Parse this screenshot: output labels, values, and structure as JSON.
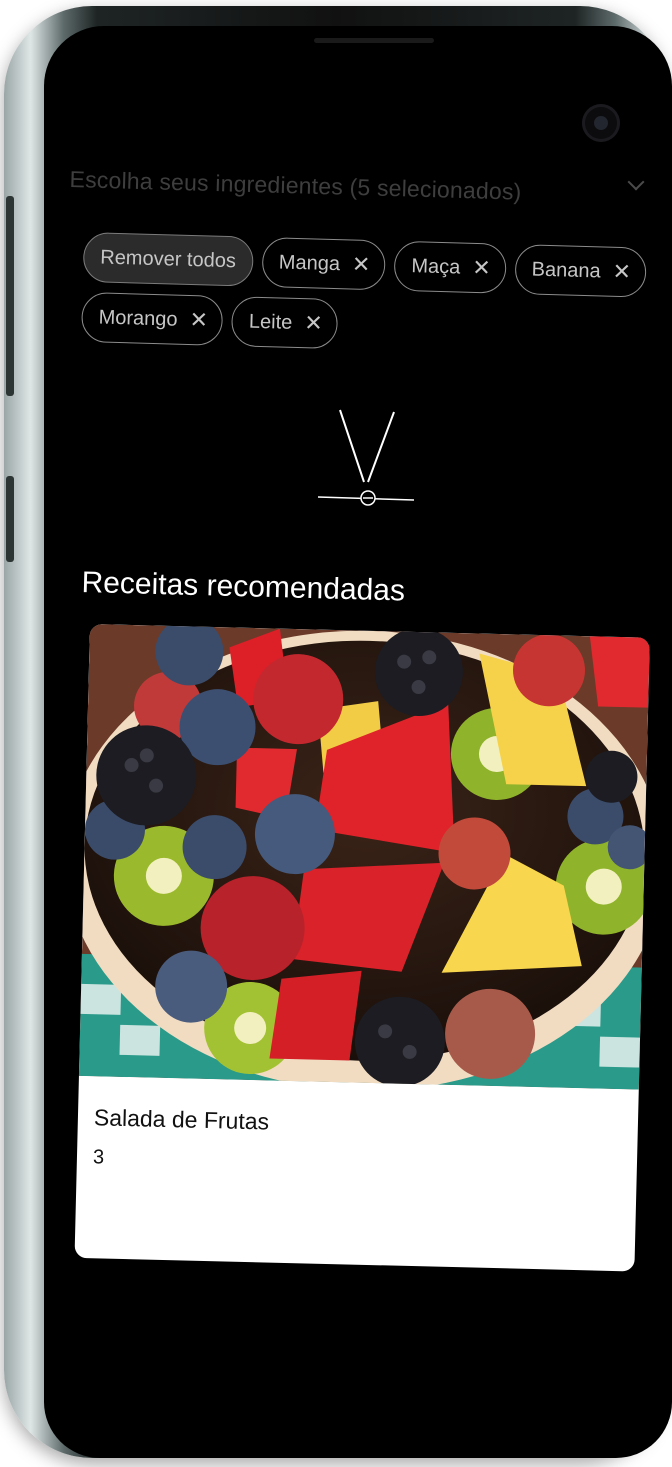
{
  "ingredient_select": {
    "label": "Escolha seus ingredientes (5 selecionados)",
    "icon": "chevron-down-icon"
  },
  "chips": {
    "remove_all": "Remover todos",
    "items": [
      {
        "label": "Manga"
      },
      {
        "label": "Maça"
      },
      {
        "label": "Banana"
      },
      {
        "label": "Morango"
      },
      {
        "label": "Leite"
      }
    ],
    "remove_icon": "close-icon"
  },
  "section": {
    "title": "Receitas recomendadas"
  },
  "recipes": [
    {
      "title": "Salada de Frutas",
      "count": "3"
    }
  ],
  "colors": {
    "background": "#000000",
    "chip_border": "#8b8b8b",
    "chip_text": "#c6c6c6",
    "card_background": "#ffffff"
  }
}
